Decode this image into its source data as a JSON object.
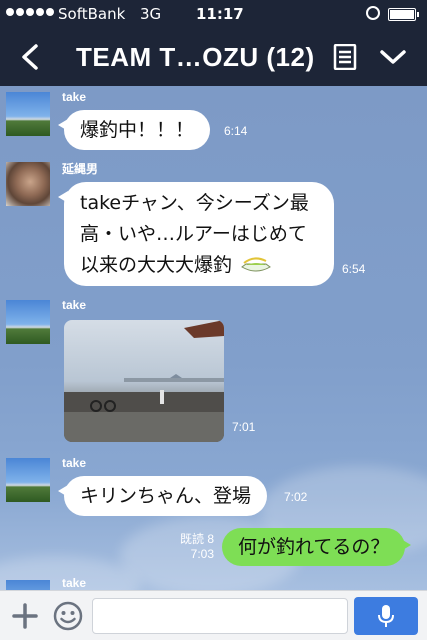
{
  "status_bar": {
    "carrier": "SoftBank",
    "network": "3G",
    "time": "11:17"
  },
  "header": {
    "title": "TEAM T…OZU (12)",
    "icons": [
      "back-chevron-icon",
      "note-icon",
      "chevron-down-icon"
    ]
  },
  "messages": [
    {
      "sender": "take",
      "text": "爆釣中！！！",
      "time": "6:14"
    },
    {
      "sender": "延縄男",
      "lines": [
        "takeチャン、今シーズン最",
        "高・いや…ルアーはじめて",
        "以来の大大大爆釣"
      ],
      "emoji": "fishing-boat-emoji",
      "time": "6:54"
    },
    {
      "sender": "take",
      "type": "photo",
      "time": "7:01"
    },
    {
      "sender": "take",
      "text": "キリンちゃん、登場",
      "time": "7:02"
    },
    {
      "sender": "me",
      "text": "何が釣れてるの？",
      "read": "既読 8",
      "time": "7:03"
    },
    {
      "sender": "take"
    }
  ],
  "input": {
    "placeholder": ""
  },
  "colors": {
    "header_bg": "#1d2537",
    "chat_bg": "#7f9bc6",
    "my_bubble": "#7ede55",
    "mic_button": "#3d7ce0"
  }
}
